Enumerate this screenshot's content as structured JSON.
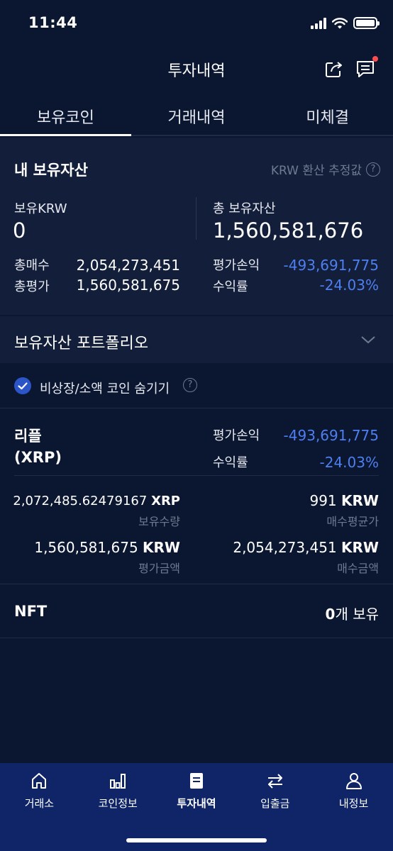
{
  "status": {
    "time": "11:44"
  },
  "header": {
    "title": "투자내역"
  },
  "tabs": [
    {
      "label": "보유코인",
      "active": true
    },
    {
      "label": "거래내역",
      "active": false
    },
    {
      "label": "미체결",
      "active": false
    }
  ],
  "assets": {
    "title": "내 보유자산",
    "note": "KRW 환산 추정값",
    "krw_label": "보유KRW",
    "krw_value": "0",
    "total_label": "총 보유자산",
    "total_value": "1,560,581,676",
    "buy_label": "총매수",
    "buy_value": "2,054,273,451",
    "eval_label": "총평가",
    "eval_value": "1,560,581,675",
    "pl_label": "평가손익",
    "pl_value": "-493,691,775",
    "rate_label": "수익률",
    "rate_value": "-24.03%"
  },
  "portfolio": {
    "title": "보유자산 포트폴리오"
  },
  "hide_small": {
    "label": "비상장/소액 코인 숨기기",
    "checked": true
  },
  "coin": {
    "name": "리플",
    "symbol": "(XRP)",
    "pl_label": "평가손익",
    "pl_value": "-493,691,775",
    "rate_label": "수익률",
    "rate_value": "-24.03%",
    "qty_value": "2,072,485.62479167",
    "qty_unit": "XRP",
    "qty_label": "보유수량",
    "avg_value": "991",
    "avg_unit": "KRW",
    "avg_label": "매수평균가",
    "eval_value": "1,560,581,675",
    "eval_unit": "KRW",
    "eval_label": "평가금액",
    "buy_value": "2,054,273,451",
    "buy_unit": "KRW",
    "buy_label": "매수금액"
  },
  "nft": {
    "title": "NFT",
    "count": "0",
    "suffix": "개 보유"
  },
  "nav": [
    {
      "label": "거래소",
      "icon": "home-icon"
    },
    {
      "label": "코인정보",
      "icon": "bar-chart-icon"
    },
    {
      "label": "투자내역",
      "icon": "document-icon",
      "active": true
    },
    {
      "label": "입출금",
      "icon": "transfer-icon"
    },
    {
      "label": "내정보",
      "icon": "person-icon"
    }
  ],
  "colors": {
    "background": "#0b1631",
    "panel": "#131f3a",
    "accent_blue": "#4e7ff0",
    "nav": "#0f2567"
  }
}
